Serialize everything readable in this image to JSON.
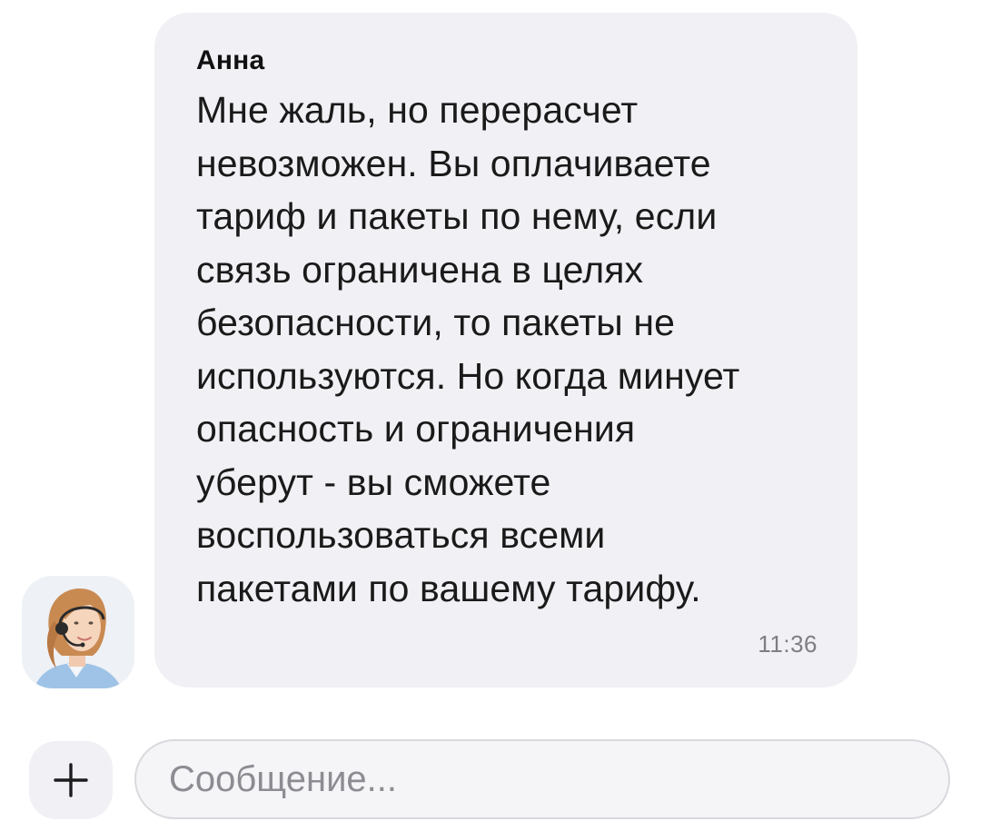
{
  "message": {
    "sender": "Анна",
    "text": "Мне жаль, но перерасчет\nневозможен. Вы оплачиваете\nтариф и пакеты по нему, если\nсвязь ограничена в целях\nбезопасности, то пакеты не\nиспользуются. Но когда минует\nопасность и ограничения\nуберут - вы сможете\nвоспользоваться всеми\nпакетами по вашему тарифу.",
    "time": "11:36",
    "avatar_icon": "support-agent-avatar"
  },
  "composer": {
    "add_icon": "plus-icon",
    "placeholder": "Сообщение...",
    "value": ""
  },
  "colors": {
    "bubble_bg": "#f1f1f5",
    "text": "#1a1a1a",
    "time": "#7d7d83",
    "input_border": "#d9d9de",
    "placeholder": "#8c8c92"
  }
}
